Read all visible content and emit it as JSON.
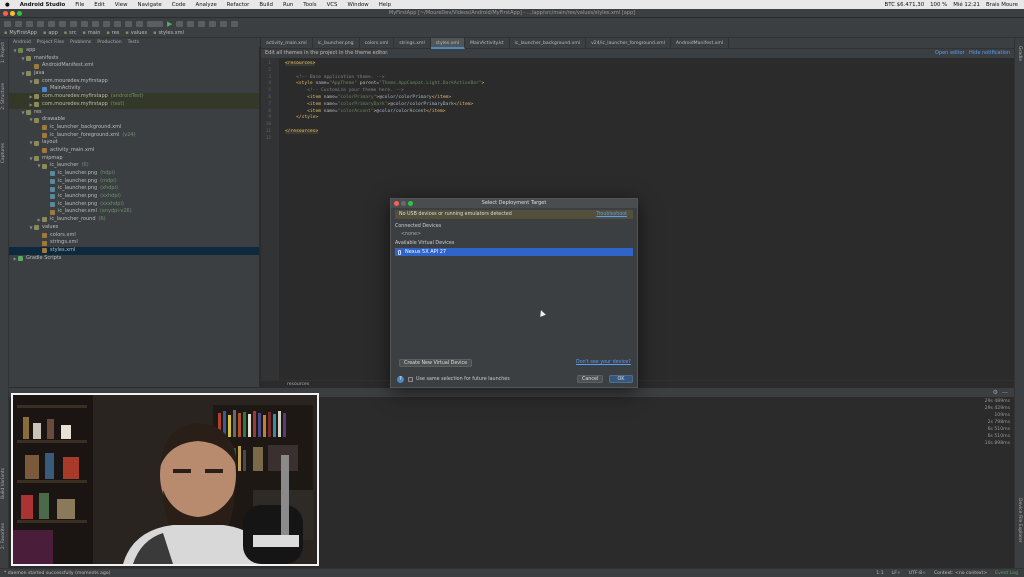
{
  "menubar": {
    "app": "Android Studio",
    "items": [
      "File",
      "Edit",
      "View",
      "Navigate",
      "Code",
      "Analyze",
      "Refactor",
      "Build",
      "Run",
      "Tools",
      "VCS",
      "Window",
      "Help"
    ],
    "right": [
      "BTC $6.471,30",
      "100 %",
      "Mié 12:21",
      "Brais Moure"
    ]
  },
  "window_title": "MyFirstApp [~/MoureDev/Videos/Android/MyFirstApp] - .../app/src/main/res/values/styles.xml [app]",
  "breadcrumbs": [
    "MyFirstApp",
    "app",
    "src",
    "main",
    "res",
    "values",
    "styles.xml"
  ],
  "project_tabs": [
    "Android",
    "Project Files",
    "Problems",
    "Production",
    "Tests"
  ],
  "left_strip": [
    "1: Project",
    "2: Structure",
    "Captures",
    "Build Variants",
    "2: Favorites"
  ],
  "right_strip": [
    "Gradle",
    "Device File Explorer"
  ],
  "tree": [
    {
      "label": "app",
      "indent": 0,
      "arrow": "▼",
      "color": "#6a8a4a"
    },
    {
      "label": "manifests",
      "indent": 1,
      "arrow": "▼",
      "color": "#8a8a5a"
    },
    {
      "label": "AndroidManifest.xml",
      "indent": 2,
      "arrow": "",
      "color": "#a07a3a"
    },
    {
      "label": "java",
      "indent": 1,
      "arrow": "▼",
      "color": "#8a8a5a"
    },
    {
      "label": "com.mouredev.myfirstapp",
      "indent": 2,
      "arrow": "▼",
      "color": "#8a8a5a"
    },
    {
      "label": "MainActivity",
      "indent": 3,
      "arrow": "",
      "color": "#4a88c7"
    },
    {
      "label": "com.mouredev.myfirstapp",
      "indent": 2,
      "arrow": "▶",
      "color": "#8a8a5a",
      "muted": "(androidTest)",
      "hl": true
    },
    {
      "label": "com.mouredev.myfirstapp",
      "indent": 2,
      "arrow": "▶",
      "color": "#8a8a5a",
      "muted": "(test)",
      "hl": true
    },
    {
      "label": "res",
      "indent": 1,
      "arrow": "▼",
      "color": "#8a8a5a"
    },
    {
      "label": "drawable",
      "indent": 2,
      "arrow": "▼",
      "color": "#8a8a5a"
    },
    {
      "label": "ic_launcher_background.xml",
      "indent": 3,
      "arrow": "",
      "color": "#a07a3a"
    },
    {
      "label": "ic_launcher_foreground.xml",
      "indent": 3,
      "arrow": "",
      "color": "#a07a3a",
      "muted": "(v24)"
    },
    {
      "label": "layout",
      "indent": 2,
      "arrow": "▼",
      "color": "#8a8a5a"
    },
    {
      "label": "activity_main.xml",
      "indent": 3,
      "arrow": "",
      "color": "#a07a3a"
    },
    {
      "label": "mipmap",
      "indent": 2,
      "arrow": "▼",
      "color": "#8a8a5a"
    },
    {
      "label": "ic_launcher",
      "indent": 3,
      "arrow": "▼",
      "color": "#8a8a5a",
      "muted": "(6)"
    },
    {
      "label": "ic_launcher.png",
      "indent": 4,
      "arrow": "",
      "color": "#5a8a9a",
      "muted": "(hdpi)"
    },
    {
      "label": "ic_launcher.png",
      "indent": 4,
      "arrow": "",
      "color": "#5a8a9a",
      "muted": "(mdpi)"
    },
    {
      "label": "ic_launcher.png",
      "indent": 4,
      "arrow": "",
      "color": "#5a8a9a",
      "muted": "(xhdpi)"
    },
    {
      "label": "ic_launcher.png",
      "indent": 4,
      "arrow": "",
      "color": "#5a8a9a",
      "muted": "(xxhdpi)"
    },
    {
      "label": "ic_launcher.png",
      "indent": 4,
      "arrow": "",
      "color": "#5a8a9a",
      "muted": "(xxxhdpi)"
    },
    {
      "label": "ic_launcher.xml",
      "indent": 4,
      "arrow": "",
      "color": "#a07a3a",
      "muted": "(anydpi-v26)"
    },
    {
      "label": "ic_launcher_round",
      "indent": 3,
      "arrow": "▶",
      "color": "#8a8a5a",
      "muted": "(6)"
    },
    {
      "label": "values",
      "indent": 2,
      "arrow": "▼",
      "color": "#8a8a5a"
    },
    {
      "label": "colors.xml",
      "indent": 3,
      "arrow": "",
      "color": "#a07a3a"
    },
    {
      "label": "strings.xml",
      "indent": 3,
      "arrow": "",
      "color": "#a07a3a"
    },
    {
      "label": "styles.xml",
      "indent": 3,
      "arrow": "",
      "color": "#a07a3a",
      "selected": true
    },
    {
      "label": "Gradle Scripts",
      "indent": 0,
      "arrow": "▶",
      "color": "#59a869"
    }
  ],
  "editor_tabs": [
    "activity_main.xml",
    "ic_launcher.png",
    "colors.xml",
    "strings.xml",
    "styles.xml",
    "MainActivity.kt",
    "ic_launcher_background.xml",
    "v24/ic_launcher_foreground.xml",
    "AndroidManifest.xml"
  ],
  "active_tab": "styles.xml",
  "banner": {
    "text": "Edit all themes in the project in the theme editor.",
    "open": "Open editor",
    "hide": "Hide notification"
  },
  "code": [
    "<resources>",
    "",
    "    <!-- Base application theme. -->",
    "    <style name=\"AppTheme\" parent=\"Theme.AppCompat.Light.DarkActionBar\">",
    "        <!-- Customize your theme here. -->",
    "        <item name=\"colorPrimary\">@color/colorPrimary</item>",
    "        <item name=\"colorPrimaryDark\">@color/colorPrimaryDark</item>",
    "        <item name=\"colorAccent\">@color/colorAccent</item>",
    "    </style>",
    "",
    "</resources>",
    ""
  ],
  "line_numbers": [
    "1",
    "2",
    "3",
    "4",
    "5",
    "6",
    "7",
    "8",
    "9",
    "10",
    "11",
    "12"
  ],
  "resources_label": "resources",
  "timings": [
    "29s 489ms",
    "29s 429ms",
    "109ms",
    "2s 798ms",
    "6s 510ms",
    "6s 510ms",
    "10s 898ms"
  ],
  "dialog": {
    "title": "Select Deployment Target",
    "warning": "No USB devices or running emulators detected",
    "troubleshoot": "Troubleshoot",
    "connected_label": "Connected Devices",
    "none": "<none>",
    "available_label": "Available Virtual Devices",
    "device": "Nexus 5X API 27",
    "create_button": "Create New Virtual Device",
    "dont_see": "Don't see your device?",
    "checkbox_label": "Use same selection for future launches",
    "cancel": "Cancel",
    "ok": "OK"
  },
  "status": {
    "left": "* daemon started successfully (moments ago)",
    "right": [
      "1:1",
      "LF÷",
      "UTF-8÷",
      "Context: <no context>"
    ],
    "event_log": "Event Log"
  }
}
